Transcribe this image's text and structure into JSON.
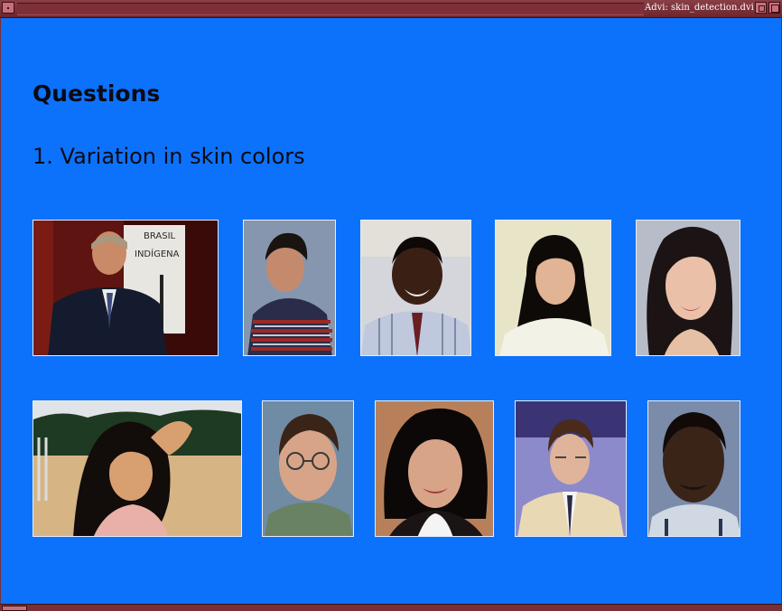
{
  "window": {
    "title": "Advi: skin_detection.dvi"
  },
  "slide": {
    "heading": "Questions",
    "list_item": "1.  Variation in skin colors",
    "photos_row1": [
      "photo-man-suit-brasil-indigena",
      "photo-boy-striped-sweater",
      "photo-smiling-man-striped-shirt",
      "photo-woman-long-black-hair",
      "photo-woman-portrait-soft"
    ],
    "photos_row2": [
      "photo-woman-beach-sunset",
      "photo-man-glasses",
      "photo-woman-short-dark-hair",
      "photo-man-tan-suit",
      "photo-man-dark-skin"
    ],
    "photo1_caption_lines": [
      "BRASIL",
      "INDÍGENA"
    ]
  },
  "colors": {
    "slide_background": "#0d72fb",
    "window_frame": "#7a2e36",
    "text": "#0a0a14"
  }
}
